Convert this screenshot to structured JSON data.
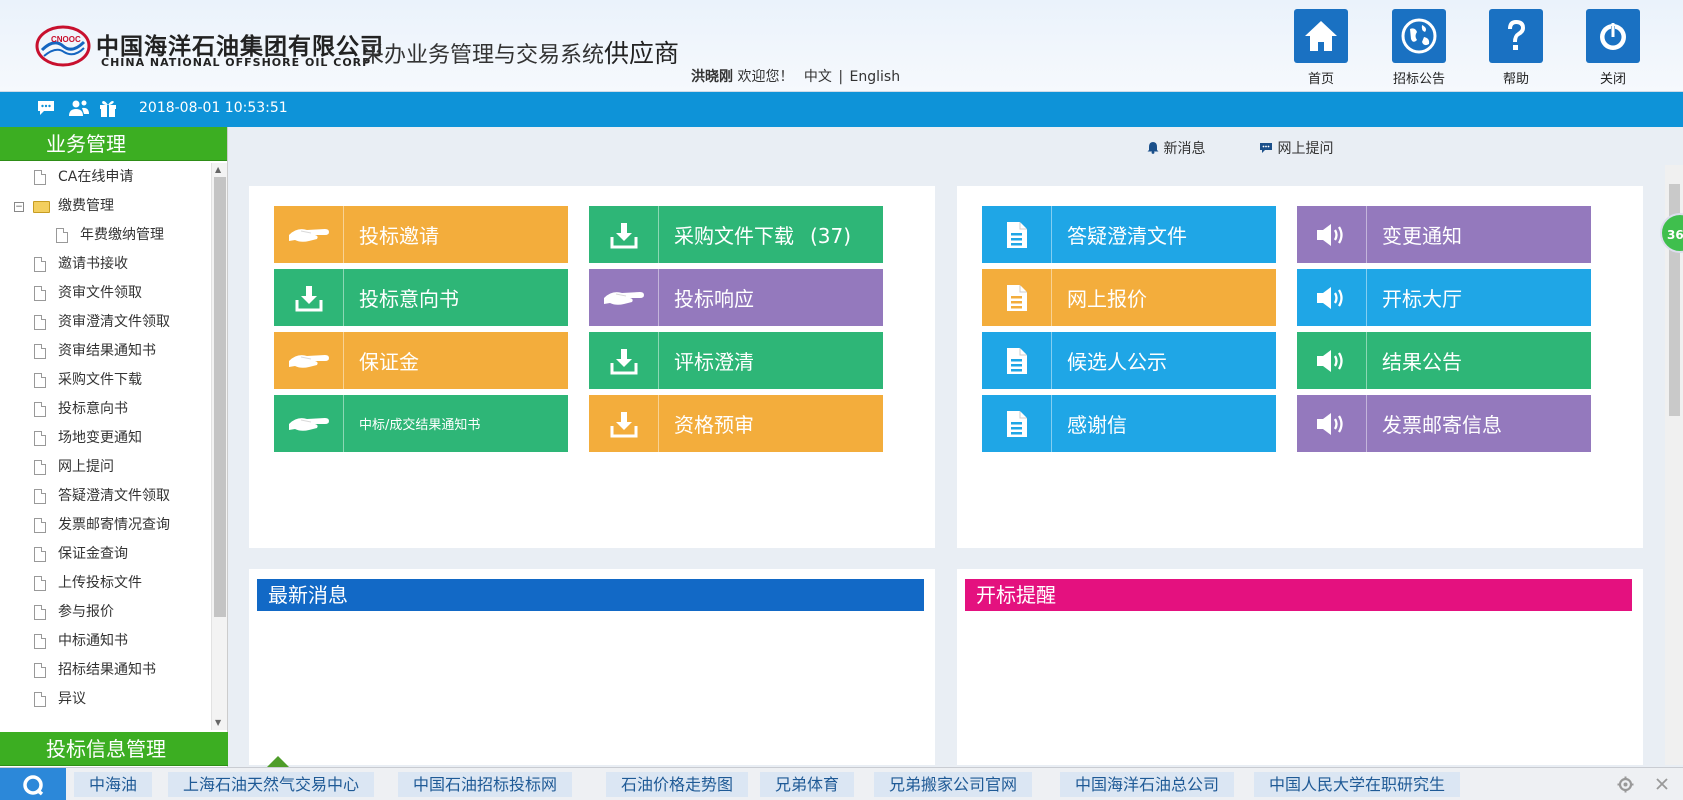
{
  "header": {
    "company_cn": "中国海洋石油集团有限公司",
    "company_en": "CHINA NATIONAL OFFSHORE OIL CORP",
    "logo_text": "CNOOC",
    "system_title": "采办业务管理与交易系统",
    "role": "供应商",
    "user_name": "洪晓刚",
    "welcome": "欢迎您！",
    "lang_cn": "中文",
    "lang_sep": "|",
    "lang_en": "English",
    "buttons": [
      {
        "label": "首页",
        "icon": "home-icon"
      },
      {
        "label": "招标公告",
        "icon": "globe-icon"
      },
      {
        "label": "帮助",
        "icon": "help-icon"
      },
      {
        "label": "关闭",
        "icon": "power-icon"
      }
    ],
    "accent_color": "#1a71c2"
  },
  "infobar": {
    "icons": [
      "chat-icon",
      "users-icon",
      "gift-icon"
    ],
    "datetime": "2018-08-01 10:53:51",
    "color": "#0e93d8"
  },
  "sidebar": {
    "header": "业务管理",
    "header2": "投标信息管理",
    "items": [
      {
        "label": "CA在线申请",
        "type": "doc",
        "level": 0
      },
      {
        "label": "缴费管理",
        "type": "folder",
        "level": 0,
        "expanded": true
      },
      {
        "label": "年费缴纳管理",
        "type": "doc",
        "level": 1
      },
      {
        "label": "邀请书接收",
        "type": "doc",
        "level": 0
      },
      {
        "label": "资审文件领取",
        "type": "doc",
        "level": 0
      },
      {
        "label": "资审澄清文件领取",
        "type": "doc",
        "level": 0
      },
      {
        "label": "资审结果通知书",
        "type": "doc",
        "level": 0
      },
      {
        "label": "采购文件下载",
        "type": "doc",
        "level": 0
      },
      {
        "label": "投标意向书",
        "type": "doc",
        "level": 0
      },
      {
        "label": "场地变更通知",
        "type": "doc",
        "level": 0
      },
      {
        "label": "网上提问",
        "type": "doc",
        "level": 0
      },
      {
        "label": "答疑澄清文件领取",
        "type": "doc",
        "level": 0
      },
      {
        "label": "发票邮寄情况查询",
        "type": "doc",
        "level": 0
      },
      {
        "label": "保证金查询",
        "type": "doc",
        "level": 0
      },
      {
        "label": "上传投标文件",
        "type": "doc",
        "level": 0
      },
      {
        "label": "参与报价",
        "type": "doc",
        "level": 0
      },
      {
        "label": "中标通知书",
        "type": "doc",
        "level": 0
      },
      {
        "label": "招标结果通知书",
        "type": "doc",
        "level": 0
      },
      {
        "label": "异议",
        "type": "doc",
        "level": 0
      }
    ],
    "header_color": "#3cae22"
  },
  "toplinks": {
    "new_message": "新消息",
    "online_question": "网上提问"
  },
  "tiles_left": [
    {
      "label": "投标邀请",
      "icon": "handshake-icon",
      "color": "orange"
    },
    {
      "label": "采购文件下载",
      "count": "(37)",
      "icon": "download-icon",
      "color": "green"
    },
    {
      "label": "投标意向书",
      "icon": "download-icon",
      "color": "green"
    },
    {
      "label": "投标响应",
      "icon": "handshake-icon",
      "color": "purple"
    },
    {
      "label": "保证金",
      "icon": "handshake-icon",
      "color": "orange"
    },
    {
      "label": "评标澄清",
      "icon": "download-icon",
      "color": "green"
    },
    {
      "label": "中标/成交结果通知书",
      "icon": "handshake-icon",
      "color": "green",
      "small": true
    },
    {
      "label": "资格预审",
      "icon": "download-icon",
      "color": "orange"
    }
  ],
  "tiles_right": [
    {
      "label": "答疑澄清文件",
      "icon": "document-icon",
      "color": "blue"
    },
    {
      "label": "变更通知",
      "icon": "speaker-icon",
      "color": "purple"
    },
    {
      "label": "网上报价",
      "icon": "document-icon",
      "color": "orange"
    },
    {
      "label": "开标大厅",
      "icon": "speaker-icon",
      "color": "blue"
    },
    {
      "label": "候选人公示",
      "icon": "document-icon",
      "color": "blue"
    },
    {
      "label": "结果公告",
      "icon": "speaker-icon",
      "color": "green"
    },
    {
      "label": "感谢信",
      "icon": "document-icon",
      "color": "blue"
    },
    {
      "label": "发票邮寄信息",
      "icon": "speaker-icon",
      "color": "purple"
    }
  ],
  "colors": {
    "orange": "#f3ad3c",
    "green": "#2eb677",
    "purple": "#9479bd",
    "blue": "#1fa6e6"
  },
  "sections": {
    "news": {
      "title": "最新消息",
      "color": "#1269c6"
    },
    "remind": {
      "title": "开标提醒",
      "color": "#e4117f"
    }
  },
  "badge": "36",
  "bottombar": {
    "start_icon": "browser-logo-icon",
    "links": [
      "中海油",
      "上海石油天然气交易中心",
      "中国石油招标投标网",
      "石油价格走势图",
      "兄弟体育",
      "兄弟搬家公司官网",
      "中国海洋石油总公司",
      "中国人民大学在职研究生"
    ],
    "controls": [
      "settings-icon",
      "close-icon"
    ]
  }
}
